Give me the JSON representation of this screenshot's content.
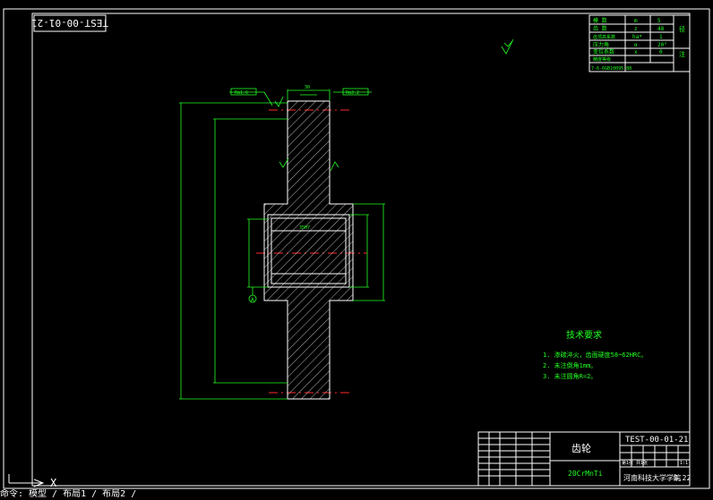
{
  "drawing": {
    "title_stamp": "TEST-00-01-21",
    "part_name": "齿轮",
    "material": "20CrMnTi",
    "drawing_number": "TEST-00-01-21",
    "school": "河南科技大学学院",
    "scale": "1:1",
    "sheet": "第1张 共1张",
    "mass_label": "0.22"
  },
  "tech_requirements": {
    "heading": "技术要求",
    "items": [
      "1. 渗碳淬火，齿面硬度58~62HRC。",
      "2. 未注倒角1mm。",
      "3. 未注圆角R=2。"
    ]
  },
  "param_table": {
    "rows": [
      [
        "模  数",
        "m",
        "5"
      ],
      [
        "齿  数",
        "z",
        "48"
      ],
      [
        "齿顶高系数",
        "ha*",
        "1"
      ],
      [
        "压力角",
        "α",
        "20°"
      ],
      [
        "变位系数",
        "x",
        "0"
      ],
      [
        "精度等级",
        "7-6-6GB10095-88",
        ""
      ]
    ],
    "side_labels": [
      "径",
      "注"
    ]
  },
  "annotations": {
    "roughness_top": "Ra1.6",
    "roughness_right": "Ra3.2",
    "width_dim": "30",
    "bore_label": "35H7",
    "datum": "A"
  },
  "command_line": "命令: 模型 / 布局1 / 布局2 /"
}
